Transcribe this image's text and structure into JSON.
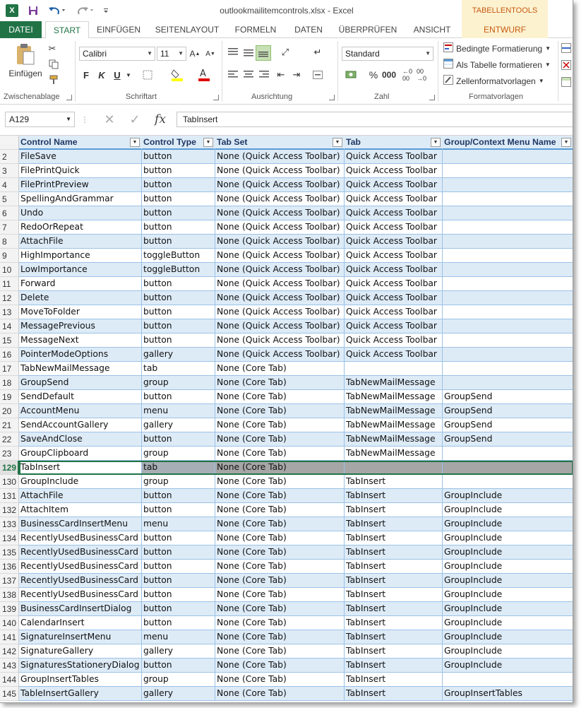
{
  "window": {
    "title": "outlookmailitemcontrols.xlsx - Excel",
    "app_icon": "X",
    "context_group": "TABELLENTOOLS"
  },
  "ribbon_tabs": [
    "DATEI",
    "START",
    "EINFÜGEN",
    "SEITENLAYOUT",
    "FORMELN",
    "DATEN",
    "ÜBERPRÜFEN",
    "ANSICHT",
    "ENTWURF"
  ],
  "ribbon": {
    "clipboard": {
      "label": "Zwischenablage",
      "paste": "Einfügen"
    },
    "font": {
      "label": "Schriftart",
      "name": "Calibri",
      "size": "11",
      "bold": "F",
      "italic": "K",
      "underline": "U"
    },
    "alignment": {
      "label": "Ausrichtung"
    },
    "number": {
      "label": "Zahl",
      "format": "Standard"
    },
    "styles": {
      "label": "Formatvorlagen",
      "conditional": "Bedingte Formatierung",
      "as_table": "Als Tabelle formatieren",
      "cell_styles": "Zellenformatvorlagen"
    }
  },
  "formula_bar": {
    "name_box": "A129",
    "value": "TabInsert",
    "fx": "fx"
  },
  "colors": {
    "excel_green": "#217346",
    "band": "#ddebf7",
    "header_text": "#1f3864",
    "selection": "#a6a6a6",
    "tabletools": "#c55a11"
  },
  "table": {
    "headers": [
      "Control Name",
      "Control Type",
      "Tab Set",
      "Tab",
      "Group/Context Menu Name"
    ],
    "rows": [
      {
        "n": "2",
        "cells": [
          "FileSave",
          "button",
          "None (Quick Access Toolbar)",
          "Quick Access Toolbar",
          ""
        ]
      },
      {
        "n": "3",
        "cells": [
          "FilePrintQuick",
          "button",
          "None (Quick Access Toolbar)",
          "Quick Access Toolbar",
          ""
        ]
      },
      {
        "n": "4",
        "cells": [
          "FilePrintPreview",
          "button",
          "None (Quick Access Toolbar)",
          "Quick Access Toolbar",
          ""
        ]
      },
      {
        "n": "5",
        "cells": [
          "SpellingAndGrammar",
          "button",
          "None (Quick Access Toolbar)",
          "Quick Access Toolbar",
          ""
        ]
      },
      {
        "n": "6",
        "cells": [
          "Undo",
          "button",
          "None (Quick Access Toolbar)",
          "Quick Access Toolbar",
          ""
        ]
      },
      {
        "n": "7",
        "cells": [
          "RedoOrRepeat",
          "button",
          "None (Quick Access Toolbar)",
          "Quick Access Toolbar",
          ""
        ]
      },
      {
        "n": "8",
        "cells": [
          "AttachFile",
          "button",
          "None (Quick Access Toolbar)",
          "Quick Access Toolbar",
          ""
        ]
      },
      {
        "n": "9",
        "cells": [
          "HighImportance",
          "toggleButton",
          "None (Quick Access Toolbar)",
          "Quick Access Toolbar",
          ""
        ]
      },
      {
        "n": "10",
        "cells": [
          "LowImportance",
          "toggleButton",
          "None (Quick Access Toolbar)",
          "Quick Access Toolbar",
          ""
        ]
      },
      {
        "n": "11",
        "cells": [
          "Forward",
          "button",
          "None (Quick Access Toolbar)",
          "Quick Access Toolbar",
          ""
        ]
      },
      {
        "n": "12",
        "cells": [
          "Delete",
          "button",
          "None (Quick Access Toolbar)",
          "Quick Access Toolbar",
          ""
        ]
      },
      {
        "n": "13",
        "cells": [
          "MoveToFolder",
          "button",
          "None (Quick Access Toolbar)",
          "Quick Access Toolbar",
          ""
        ]
      },
      {
        "n": "14",
        "cells": [
          "MessagePrevious",
          "button",
          "None (Quick Access Toolbar)",
          "Quick Access Toolbar",
          ""
        ]
      },
      {
        "n": "15",
        "cells": [
          "MessageNext",
          "button",
          "None (Quick Access Toolbar)",
          "Quick Access Toolbar",
          ""
        ]
      },
      {
        "n": "16",
        "cells": [
          "PointerModeOptions",
          "gallery",
          "None (Quick Access Toolbar)",
          "Quick Access Toolbar",
          ""
        ]
      },
      {
        "n": "17",
        "cells": [
          "TabNewMailMessage",
          "tab",
          "None (Core Tab)",
          "",
          ""
        ]
      },
      {
        "n": "18",
        "cells": [
          "GroupSend",
          "group",
          "None (Core Tab)",
          "TabNewMailMessage",
          ""
        ]
      },
      {
        "n": "19",
        "cells": [
          "SendDefault",
          "button",
          "None (Core Tab)",
          "TabNewMailMessage",
          "GroupSend"
        ]
      },
      {
        "n": "20",
        "cells": [
          "AccountMenu",
          "menu",
          "None (Core Tab)",
          "TabNewMailMessage",
          "GroupSend"
        ]
      },
      {
        "n": "21",
        "cells": [
          "SendAccountGallery",
          "gallery",
          "None (Core Tab)",
          "TabNewMailMessage",
          "GroupSend"
        ]
      },
      {
        "n": "22",
        "cells": [
          "SaveAndClose",
          "button",
          "None (Core Tab)",
          "TabNewMailMessage",
          "GroupSend"
        ]
      },
      {
        "n": "23",
        "cells": [
          "GroupClipboard",
          "group",
          "None (Core Tab)",
          "TabNewMailMessage",
          ""
        ]
      },
      {
        "n": "129",
        "cells": [
          "TabInsert",
          "tab",
          "None (Core Tab)",
          "",
          ""
        ],
        "selected": true
      },
      {
        "n": "130",
        "cells": [
          "GroupInclude",
          "group",
          "None (Core Tab)",
          "TabInsert",
          ""
        ]
      },
      {
        "n": "131",
        "cells": [
          "AttachFile",
          "button",
          "None (Core Tab)",
          "TabInsert",
          "GroupInclude"
        ]
      },
      {
        "n": "132",
        "cells": [
          "AttachItem",
          "button",
          "None (Core Tab)",
          "TabInsert",
          "GroupInclude"
        ]
      },
      {
        "n": "133",
        "cells": [
          "BusinessCardInsertMenu",
          "menu",
          "None (Core Tab)",
          "TabInsert",
          "GroupInclude"
        ]
      },
      {
        "n": "134",
        "cells": [
          "RecentlyUsedBusinessCard",
          "button",
          "None (Core Tab)",
          "TabInsert",
          "GroupInclude"
        ]
      },
      {
        "n": "135",
        "cells": [
          "RecentlyUsedBusinessCard",
          "button",
          "None (Core Tab)",
          "TabInsert",
          "GroupInclude"
        ]
      },
      {
        "n": "136",
        "cells": [
          "RecentlyUsedBusinessCard",
          "button",
          "None (Core Tab)",
          "TabInsert",
          "GroupInclude"
        ]
      },
      {
        "n": "137",
        "cells": [
          "RecentlyUsedBusinessCard",
          "button",
          "None (Core Tab)",
          "TabInsert",
          "GroupInclude"
        ]
      },
      {
        "n": "138",
        "cells": [
          "RecentlyUsedBusinessCard",
          "button",
          "None (Core Tab)",
          "TabInsert",
          "GroupInclude"
        ]
      },
      {
        "n": "139",
        "cells": [
          "BusinessCardInsertDialog",
          "button",
          "None (Core Tab)",
          "TabInsert",
          "GroupInclude"
        ]
      },
      {
        "n": "140",
        "cells": [
          "CalendarInsert",
          "button",
          "None (Core Tab)",
          "TabInsert",
          "GroupInclude"
        ]
      },
      {
        "n": "141",
        "cells": [
          "SignatureInsertMenu",
          "menu",
          "None (Core Tab)",
          "TabInsert",
          "GroupInclude"
        ]
      },
      {
        "n": "142",
        "cells": [
          "SignatureGallery",
          "gallery",
          "None (Core Tab)",
          "TabInsert",
          "GroupInclude"
        ]
      },
      {
        "n": "143",
        "cells": [
          "SignaturesStationeryDialog",
          "button",
          "None (Core Tab)",
          "TabInsert",
          "GroupInclude"
        ]
      },
      {
        "n": "144",
        "cells": [
          "GroupInsertTables",
          "group",
          "None (Core Tab)",
          "TabInsert",
          ""
        ]
      },
      {
        "n": "145",
        "cells": [
          "TableInsertGallery",
          "gallery",
          "None (Core Tab)",
          "TabInsert",
          "GroupInsertTables"
        ]
      }
    ]
  }
}
